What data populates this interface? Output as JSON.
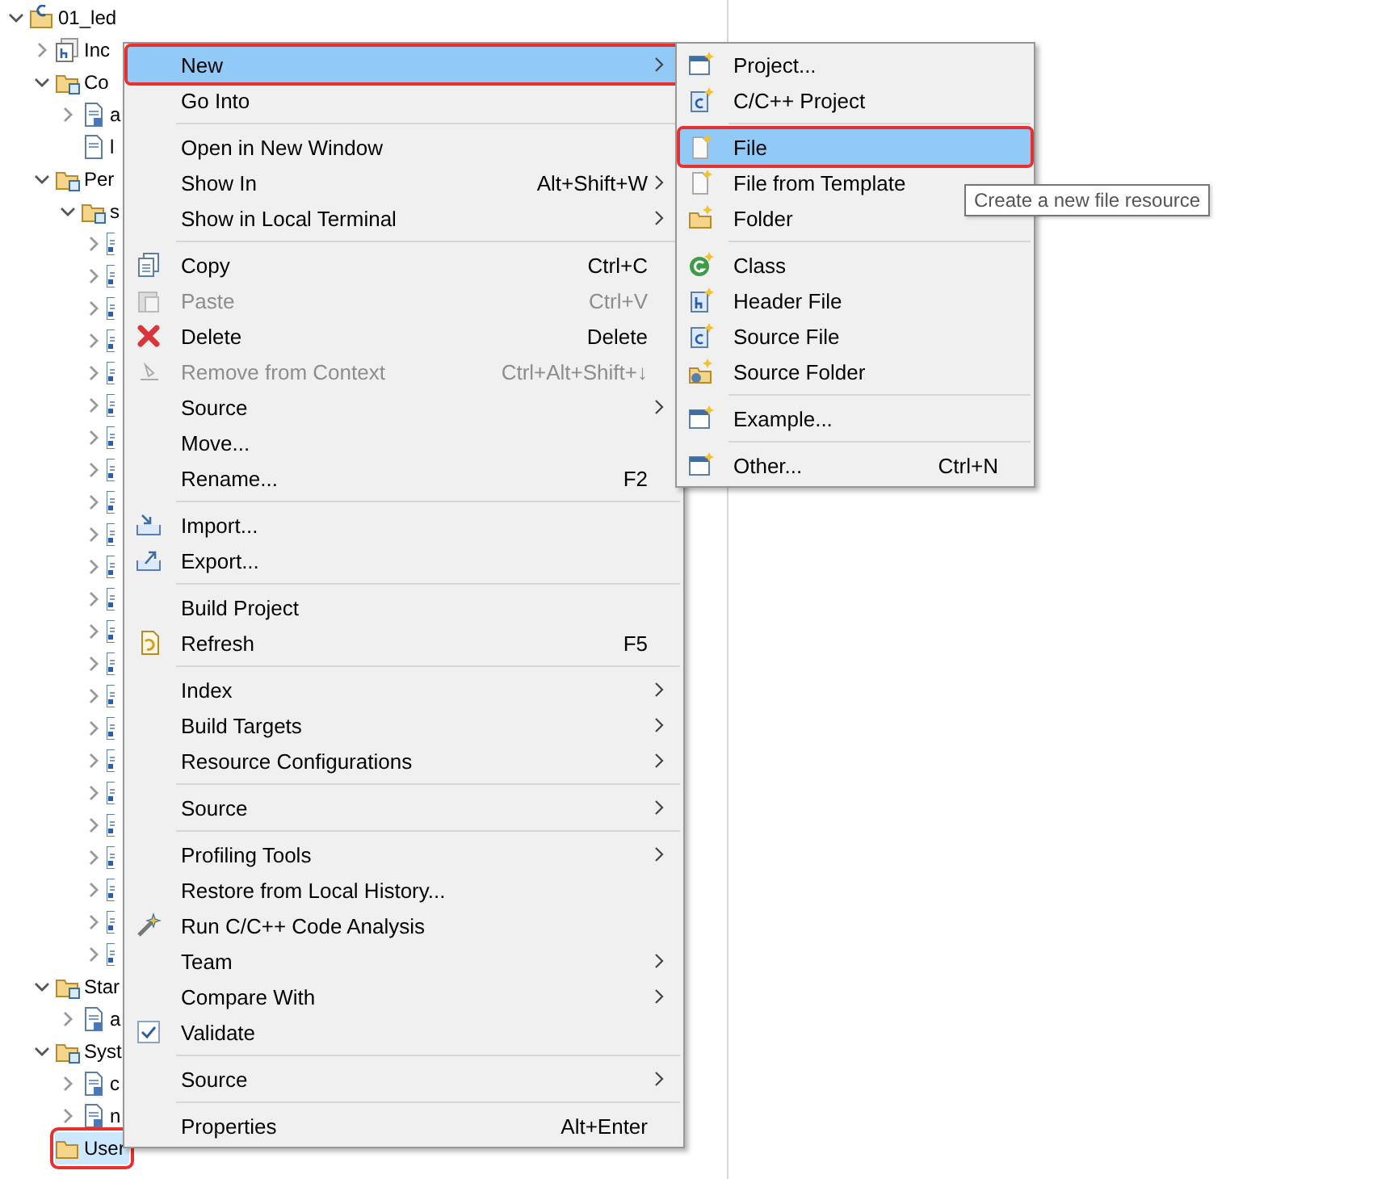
{
  "tree": [
    {
      "label": "01_led",
      "kind": "project",
      "expanded": true,
      "selected": false,
      "children": [
        {
          "label": "Inc",
          "kind": "include",
          "expanded": false,
          "selected": false
        },
        {
          "label": "Co",
          "kind": "folder",
          "expanded": true,
          "selected": false,
          "children": [
            {
              "label": "a",
              "kind": "sfile",
              "expanded": false,
              "selected": false
            },
            {
              "label": "l",
              "kind": "doc",
              "selected": false
            }
          ]
        },
        {
          "label": "Per",
          "kind": "folder",
          "expanded": true,
          "selected": false,
          "children": [
            {
              "label": "s",
              "kind": "folder",
              "expanded": true,
              "selected": false,
              "children": [
                {
                  "kind": "cfile",
                  "expanded": false,
                  "selected": false
                },
                {
                  "kind": "cfile",
                  "expanded": false,
                  "selected": false
                },
                {
                  "kind": "cfile",
                  "expanded": false,
                  "selected": false
                },
                {
                  "kind": "cfile",
                  "expanded": false,
                  "selected": false
                },
                {
                  "kind": "cfile",
                  "expanded": false,
                  "selected": false
                },
                {
                  "kind": "cfile",
                  "expanded": false,
                  "selected": false
                },
                {
                  "kind": "cfile",
                  "expanded": false,
                  "selected": false
                },
                {
                  "kind": "cfile",
                  "expanded": false,
                  "selected": false
                },
                {
                  "kind": "cfile",
                  "expanded": false,
                  "selected": false
                },
                {
                  "kind": "cfile",
                  "expanded": false,
                  "selected": false
                },
                {
                  "kind": "cfile",
                  "expanded": false,
                  "selected": false
                },
                {
                  "kind": "cfile",
                  "expanded": false,
                  "selected": false
                },
                {
                  "kind": "cfile",
                  "expanded": false,
                  "selected": false
                },
                {
                  "kind": "cfile",
                  "expanded": false,
                  "selected": false
                },
                {
                  "kind": "cfile",
                  "expanded": false,
                  "selected": false
                },
                {
                  "kind": "cfile",
                  "expanded": false,
                  "selected": false
                },
                {
                  "kind": "cfile",
                  "expanded": false,
                  "selected": false
                },
                {
                  "kind": "cfile",
                  "expanded": false,
                  "selected": false
                },
                {
                  "kind": "cfile",
                  "expanded": false,
                  "selected": false
                },
                {
                  "kind": "cfile",
                  "expanded": false,
                  "selected": false
                },
                {
                  "kind": "cfile",
                  "expanded": false,
                  "selected": false
                },
                {
                  "kind": "cfile",
                  "expanded": false,
                  "selected": false
                },
                {
                  "kind": "cfile",
                  "expanded": false,
                  "selected": false
                }
              ]
            }
          ]
        },
        {
          "label": "Star",
          "kind": "folder",
          "expanded": true,
          "selected": false,
          "children": [
            {
              "label": "a",
              "kind": "sfile",
              "expanded": false,
              "selected": false
            }
          ]
        },
        {
          "label": "Syst",
          "kind": "folder",
          "expanded": true,
          "selected": false,
          "children": [
            {
              "label": "c",
              "kind": "sfile",
              "expanded": false,
              "selected": false
            },
            {
              "label": "n",
              "kind": "sfile",
              "expanded": false,
              "selected": false
            }
          ]
        },
        {
          "label": "User",
          "kind": "folder-open",
          "selected": true,
          "annotated": true
        }
      ]
    }
  ],
  "context_menu": [
    {
      "kind": "text",
      "label": "New",
      "submenu": true,
      "selected": true,
      "disabled": false,
      "annotated": true
    },
    {
      "kind": "text",
      "label": "Go Into",
      "submenu": false,
      "selected": false,
      "disabled": false
    },
    {
      "kind": "separator"
    },
    {
      "kind": "text",
      "label": "Open in New Window",
      "submenu": false,
      "selected": false,
      "disabled": false
    },
    {
      "kind": "text",
      "label": "Show In",
      "shortcut": "Alt+Shift+W",
      "submenu": true,
      "selected": false,
      "disabled": false
    },
    {
      "kind": "text",
      "label": "Show in Local Terminal",
      "submenu": true,
      "selected": false,
      "disabled": false
    },
    {
      "kind": "separator"
    },
    {
      "kind": "copy",
      "label": "Copy",
      "shortcut": "Ctrl+C",
      "submenu": false,
      "selected": false,
      "disabled": false
    },
    {
      "kind": "paste",
      "label": "Paste",
      "shortcut": "Ctrl+V",
      "submenu": false,
      "selected": false,
      "disabled": true
    },
    {
      "kind": "delete",
      "label": "Delete",
      "shortcut": "Delete",
      "submenu": false,
      "selected": false,
      "disabled": false
    },
    {
      "kind": "remove",
      "label": "Remove from Context",
      "shortcut": "Ctrl+Alt+Shift+↓",
      "submenu": false,
      "selected": false,
      "disabled": true
    },
    {
      "kind": "text",
      "label": "Source",
      "submenu": true,
      "selected": false,
      "disabled": false
    },
    {
      "kind": "text",
      "label": "Move...",
      "submenu": false,
      "selected": false,
      "disabled": false
    },
    {
      "kind": "text",
      "label": "Rename...",
      "shortcut": "F2",
      "submenu": false,
      "selected": false,
      "disabled": false
    },
    {
      "kind": "separator"
    },
    {
      "kind": "import",
      "label": "Import...",
      "submenu": false,
      "selected": false,
      "disabled": false
    },
    {
      "kind": "export",
      "label": "Export...",
      "submenu": false,
      "selected": false,
      "disabled": false
    },
    {
      "kind": "separator"
    },
    {
      "kind": "text",
      "label": "Build Project",
      "submenu": false,
      "selected": false,
      "disabled": false
    },
    {
      "kind": "refresh",
      "label": "Refresh",
      "shortcut": "F5",
      "submenu": false,
      "selected": false,
      "disabled": false
    },
    {
      "kind": "separator"
    },
    {
      "kind": "text",
      "label": "Index",
      "submenu": true,
      "selected": false,
      "disabled": false
    },
    {
      "kind": "text",
      "label": "Build Targets",
      "submenu": true,
      "selected": false,
      "disabled": false
    },
    {
      "kind": "text",
      "label": "Resource Configurations",
      "submenu": true,
      "selected": false,
      "disabled": false
    },
    {
      "kind": "separator"
    },
    {
      "kind": "text",
      "label": "Source",
      "submenu": true,
      "selected": false,
      "disabled": false
    },
    {
      "kind": "separator"
    },
    {
      "kind": "text",
      "label": "Profiling Tools",
      "submenu": true,
      "selected": false,
      "disabled": false
    },
    {
      "kind": "text",
      "label": "Restore from Local History...",
      "submenu": false,
      "selected": false,
      "disabled": false
    },
    {
      "kind": "analysis",
      "label": "Run C/C++ Code Analysis",
      "submenu": false,
      "selected": false,
      "disabled": false
    },
    {
      "kind": "text",
      "label": "Team",
      "submenu": true,
      "selected": false,
      "disabled": false
    },
    {
      "kind": "text",
      "label": "Compare With",
      "submenu": true,
      "selected": false,
      "disabled": false
    },
    {
      "kind": "check",
      "label": "Validate",
      "submenu": false,
      "selected": false,
      "disabled": false
    },
    {
      "kind": "separator"
    },
    {
      "kind": "text",
      "label": "Source",
      "submenu": true,
      "selected": false,
      "disabled": false
    },
    {
      "kind": "separator"
    },
    {
      "kind": "text",
      "label": "Properties",
      "shortcut": "Alt+Enter",
      "submenu": false,
      "selected": false,
      "disabled": false
    }
  ],
  "new_submenu": [
    {
      "kind": "window",
      "label": "Project...",
      "selected": false
    },
    {
      "kind": "cproject",
      "label": "C/C++ Project",
      "selected": false
    },
    {
      "kind": "separator"
    },
    {
      "kind": "file",
      "label": "File",
      "selected": true,
      "annotated": true
    },
    {
      "kind": "file",
      "label": "File from Template",
      "selected": false
    },
    {
      "kind": "folder",
      "label": "Folder",
      "selected": false
    },
    {
      "kind": "separator"
    },
    {
      "kind": "class",
      "label": "Class",
      "selected": false
    },
    {
      "kind": "header",
      "label": "Header File",
      "selected": false
    },
    {
      "kind": "source",
      "label": "Source File",
      "selected": false
    },
    {
      "kind": "srcfolder",
      "label": "Source Folder",
      "selected": false
    },
    {
      "kind": "separator"
    },
    {
      "kind": "window",
      "label": "Example...",
      "selected": false
    },
    {
      "kind": "separator"
    },
    {
      "kind": "window",
      "label": "Other...",
      "shortcut": "Ctrl+N",
      "selected": false
    }
  ],
  "tooltip": "Create a new file resource"
}
